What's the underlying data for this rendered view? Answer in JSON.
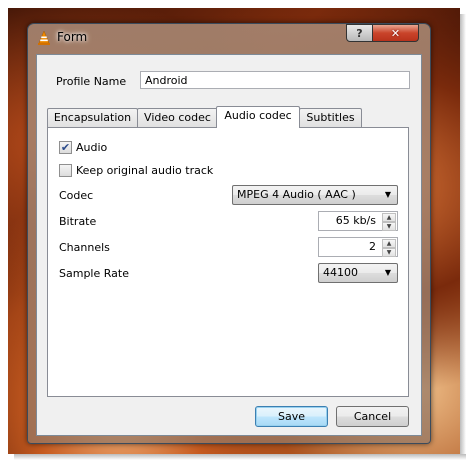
{
  "window": {
    "title": "Form",
    "help_glyph": "?",
    "close_glyph": "✕"
  },
  "profile": {
    "label": "Profile Name",
    "value": "Android"
  },
  "tabs": [
    {
      "label": "Encapsulation",
      "active": false
    },
    {
      "label": "Video codec",
      "active": false
    },
    {
      "label": "Audio codec",
      "active": true
    },
    {
      "label": "Subtitles",
      "active": false
    }
  ],
  "audio": {
    "audio_checkbox": {
      "label": "Audio",
      "checked": true
    },
    "keep_original": {
      "label": "Keep original audio track",
      "checked": false
    },
    "codec": {
      "label": "Codec",
      "value": "MPEG 4 Audio ( AAC )"
    },
    "bitrate": {
      "label": "Bitrate",
      "value": "65 kb/s"
    },
    "channels": {
      "label": "Channels",
      "value": "2"
    },
    "sample_rate": {
      "label": "Sample Rate",
      "value": "44100"
    }
  },
  "buttons": {
    "save": "Save",
    "cancel": "Cancel"
  },
  "icons": {
    "app": "vlc-cone-icon",
    "help": "help-icon",
    "close": "close-icon",
    "dropdown": "chevron-down-icon",
    "spin_up": "spin-up-icon",
    "spin_down": "spin-down-icon",
    "check": "check-icon"
  },
  "colors": {
    "default_button_border": "#3c7fb1",
    "close_button": "#c9442a",
    "vlc_orange": "#f08a00"
  }
}
